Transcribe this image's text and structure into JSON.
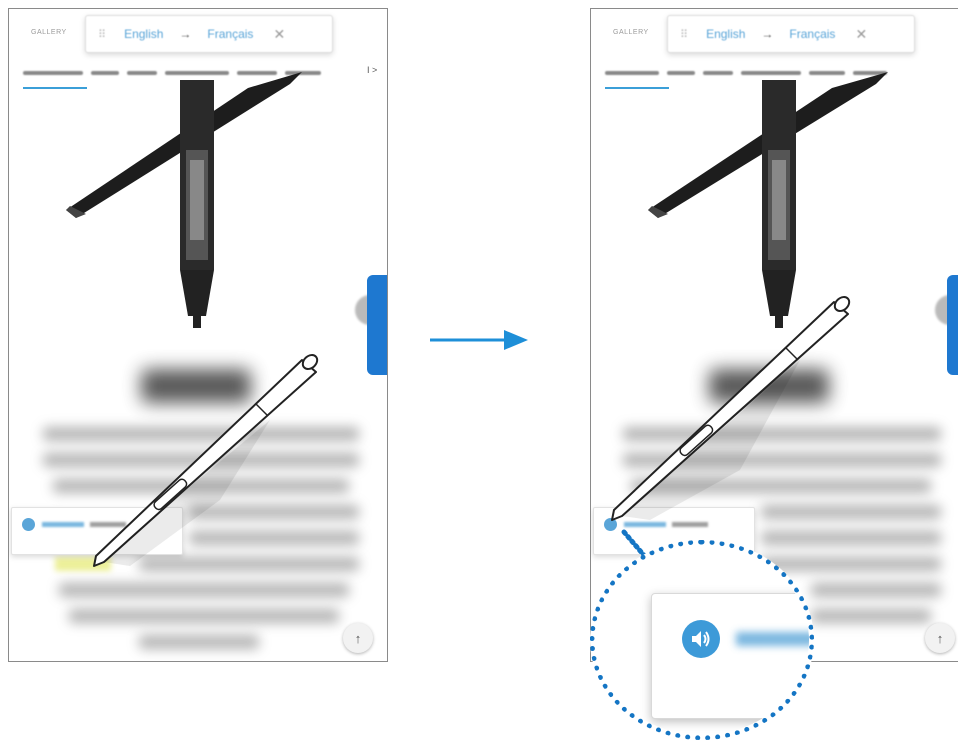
{
  "panels": {
    "gallery_label": "GALLERY",
    "source_language": "English",
    "arrow_glyph": "→",
    "target_language": "Français",
    "close_glyph": "✕",
    "grip_glyph": "⠿",
    "more_tabs_glyph": "I >",
    "scroll_up_glyph": "↑"
  },
  "icons": {
    "speaker": "speaker-icon",
    "s_pen": "s-pen-icon",
    "flow_arrow": "arrow-right-icon"
  },
  "colors": {
    "accent": "#1e8fd8",
    "highlight": "#e8ec80",
    "zoom_border": "#1475c4"
  }
}
